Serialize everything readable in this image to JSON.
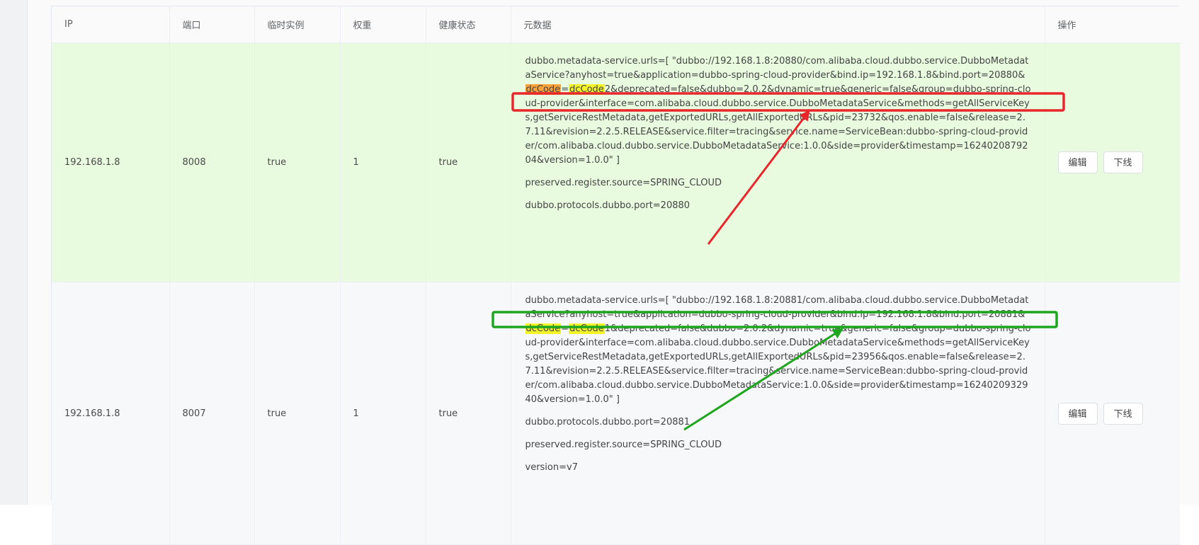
{
  "table": {
    "headers": {
      "ip": "IP",
      "port": "端口",
      "ephemeral": "临时实例",
      "weight": "权重",
      "health": "健康状态",
      "metadata": "元数据",
      "operations": "操作"
    },
    "rows": [
      {
        "ip": "192.168.1.8",
        "port": "8008",
        "ephemeral": "true",
        "weight": "1",
        "health": "true",
        "metadata": {
          "urls_prefix": "dubbo.metadata-service.urls=[ \"dubbo://192.168.1.8:20880/com.alibaba.cloud.dubbo.service.DubboMetadataService?anyhost=true&application=dubbo-spring-cloud-provider&bind.ip=192.168.1.8&bind.port=20880&",
          "key": "dcCode",
          "eq": "=",
          "value": "dcCode",
          "urls_suffix": "2&deprecated=false&dubbo=2.0.2&dynamic=true&generic=false&group=dubbo-spring-cloud-provider&interface=com.alibaba.cloud.dubbo.service.DubboMetadataService&methods=getAllServiceKeys,getServiceRestMetadata,getExportedURLs,getAllExportedURLs&pid=23732&qos.enable=false&release=2.7.11&revision=2.2.5.RELEASE&service.filter=tracing&service.name=ServiceBean:dubbo-spring-cloud-provider/com.alibaba.cloud.dubbo.service.DubboMetadataService:1.0.0&side=provider&timestamp=1624020879204&version=1.0.0\" ]",
          "entries": [
            "preserved.register.source=SPRING_CLOUD",
            "dubbo.protocols.dubbo.port=20880"
          ]
        },
        "edit_label": "编辑",
        "offline_label": "下线"
      },
      {
        "ip": "192.168.1.8",
        "port": "8007",
        "ephemeral": "true",
        "weight": "1",
        "health": "true",
        "metadata": {
          "urls_prefix": "dubbo.metadata-service.urls=[ \"dubbo://192.168.1.8:20881/com.alibaba.cloud.dubbo.service.DubboMetadataService?anyhost=true&application=dubbo-spring-cloud-provider&bind.ip=192.168.1.8&bind.port=20881&",
          "key": "dcCode",
          "eq": "=",
          "value": "dcCode",
          "urls_suffix": "1&deprecated=false&dubbo=2.0.2&dynamic=true&generic=false&group=dubbo-spring-cloud-provider&interface=com.alibaba.cloud.dubbo.service.DubboMetadataService&methods=getAllServiceKeys,getServiceRestMetadata,getExportedURLs,getAllExportedURLs&pid=23956&qos.enable=false&release=2.7.11&revision=2.2.5.RELEASE&service.filter=tracing&service.name=ServiceBean:dubbo-spring-cloud-provider/com.alibaba.cloud.dubbo.service.DubboMetadataService:1.0.0&side=provider&timestamp=1624020932940&version=1.0.0\" ]",
          "entries": [
            "dubbo.protocols.dubbo.port=20881",
            "preserved.register.source=SPRING_CLOUD",
            "version=v7"
          ]
        },
        "edit_label": "编辑",
        "offline_label": "下线"
      }
    ]
  },
  "annotations": {
    "row1_color": "#e8262b",
    "row2_color": "#1fa61f"
  },
  "highlight_colors": {
    "key": "#f7a23a",
    "value": "#f3f32a"
  }
}
